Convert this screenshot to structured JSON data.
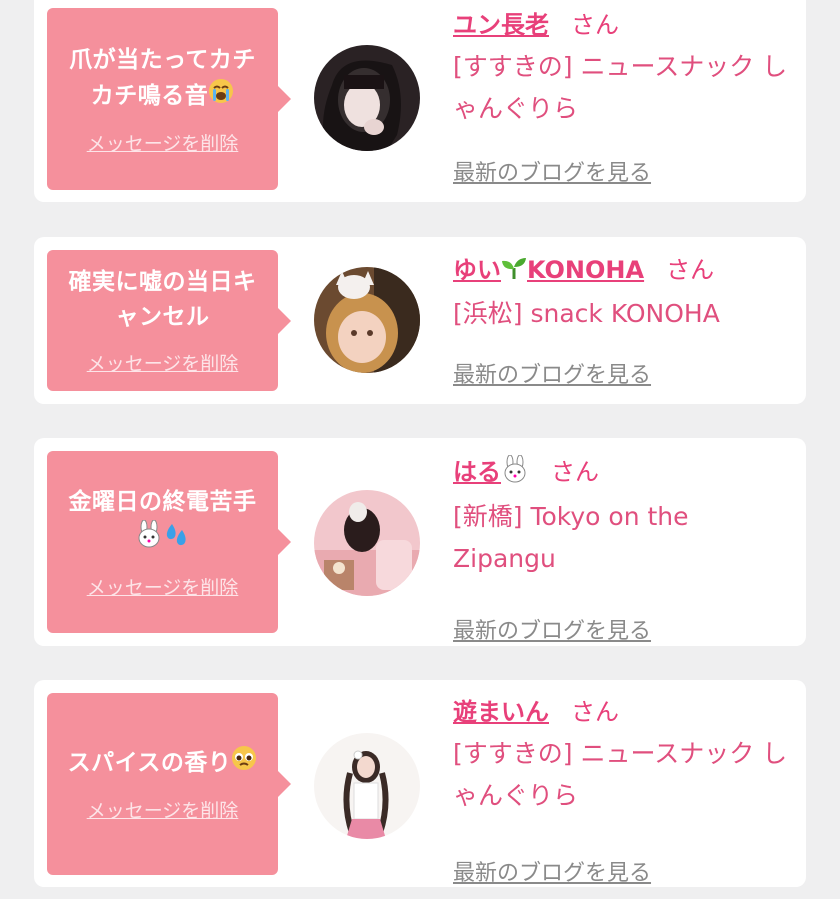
{
  "cards": [
    {
      "message_line1": "爪が当たってカチ",
      "message_line2": "カチ鳴る音",
      "message_emoji": "loudly-crying-face",
      "delete_label": "メッセージを削除",
      "name": "ユン長老",
      "honorific": "さん",
      "shop": "[すすきの] ニュースナック しゃんぐりら",
      "blog_label": "最新のブログを見る"
    },
    {
      "message_line1": "確実に嘘の当日キ",
      "message_line2": "ャンセル",
      "delete_label": "メッセージを削除",
      "name_prefix": "ゆい",
      "name_suffix": "KONOHA",
      "name_emoji": "seedling",
      "honorific": "さん",
      "shop": "[浜松] snack KONOHA",
      "blog_label": "最新のブログを見る"
    },
    {
      "message_line1": "金曜日の終電苦手",
      "message_emoji": "rabbit-face, sweat-droplets",
      "delete_label": "メッセージを削除",
      "name": "はる",
      "name_emoji": "rabbit-face",
      "honorific": "さん",
      "shop": "[新橋] Tokyo on the Zipangu",
      "blog_label": "最新のブログを見る"
    },
    {
      "message_line1": "スパイスの香り",
      "message_emoji": "pleading-face",
      "delete_label": "メッセージを削除",
      "name": "遊まいん",
      "honorific": "さん",
      "shop": "[すすきの] ニュースナック しゃんぐりら",
      "blog_label": "最新のブログを見る"
    }
  ],
  "colors": {
    "background": "#efeff0",
    "card": "#ffffff",
    "bubble": "#f5909c",
    "accent": "#e8407a",
    "link_gray": "#8a8a8a"
  }
}
